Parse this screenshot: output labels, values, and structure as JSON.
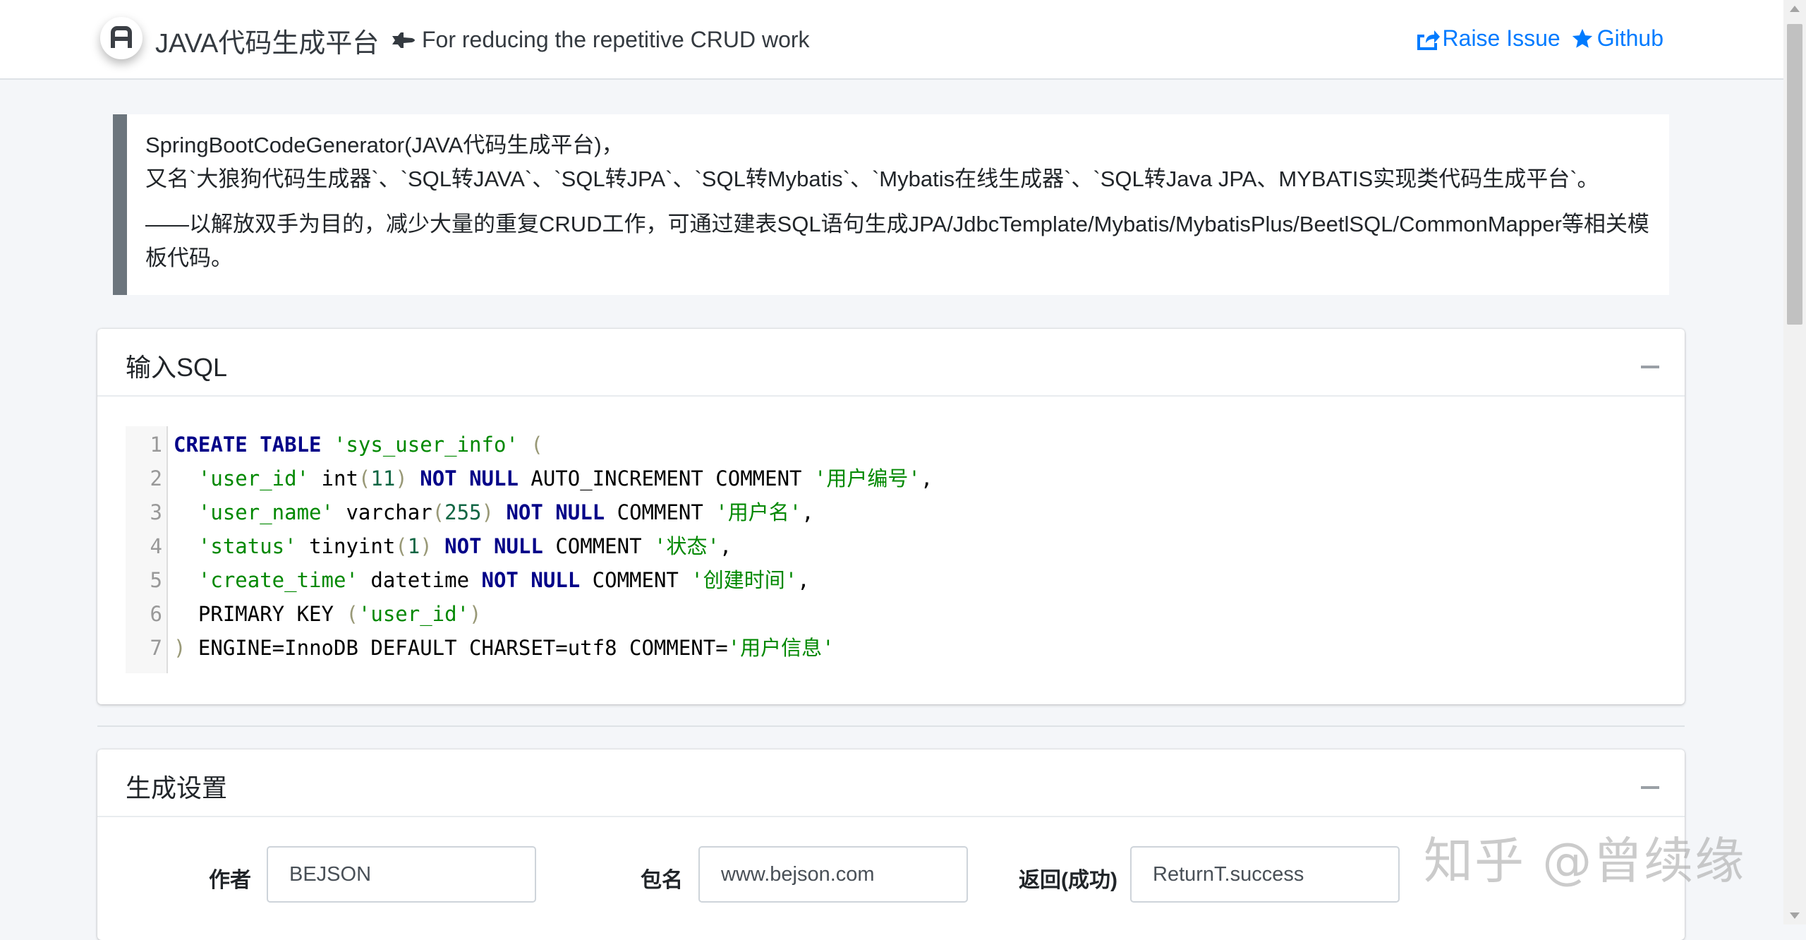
{
  "header": {
    "brand": "JAVA代码生成平台",
    "tagline": "For reducing the repetitive CRUD work",
    "links": [
      {
        "label": "Raise Issue",
        "icon": "share-square-icon"
      },
      {
        "label": "Github",
        "icon": "star-icon"
      }
    ]
  },
  "intro": {
    "line1": "SpringBootCodeGenerator(JAVA代码生成平台)，",
    "line2": "又名`大狼狗代码生成器`、`SQL转JAVA`、`SQL转JPA`、`SQL转Mybatis`、`Mybatis在线生成器`、`SQL转Java JPA、MYBATIS实现类代码生成平台`。",
    "line3": "——以解放双手为目的，减少大量的重复CRUD工作，可通过建表SQL语句生成JPA/JdbcTemplate/Mybatis/MybatisPlus/BeetlSQL/CommonMapper等相关模板代码。"
  },
  "sql_card": {
    "title": "输入SQL",
    "line_numbers": [
      "1",
      "2",
      "3",
      "4",
      "5",
      "6",
      "7"
    ],
    "lines": [
      [
        "CREATE TABLE",
        " ",
        "'sys_user_info'",
        " ",
        "("
      ],
      [
        "  ",
        "'user_id'",
        " int",
        "(",
        "11",
        ")",
        " ",
        "NOT NULL",
        " AUTO_INCREMENT COMMENT ",
        "'用户编号'",
        ","
      ],
      [
        "  ",
        "'user_name'",
        " varchar",
        "(",
        "255",
        ")",
        " ",
        "NOT NULL",
        " COMMENT ",
        "'用户名'",
        ","
      ],
      [
        "  ",
        "'status'",
        " tinyint",
        "(",
        "1",
        ")",
        " ",
        "NOT NULL",
        " COMMENT ",
        "'状态'",
        ","
      ],
      [
        "  ",
        "'create_time'",
        " datetime ",
        "NOT NULL",
        " COMMENT ",
        "'创建时间'",
        ","
      ],
      [
        "  PRIMARY KEY ",
        "(",
        "'user_id'",
        ")"
      ],
      [
        ")",
        " ENGINE=InnoDB DEFAULT CHARSET=utf8 COMMENT=",
        "'用户信息'"
      ]
    ]
  },
  "settings_card": {
    "title": "生成设置",
    "fields": [
      {
        "label": "作者",
        "value": "BEJSON"
      },
      {
        "label": "包名",
        "value": "www.bejson.com"
      },
      {
        "label": "返回(成功)",
        "value": "ReturnT.success"
      }
    ]
  },
  "watermark": "知乎 @曾续缘",
  "colors": {
    "link": "#007bff",
    "keyword": "#000088",
    "string": "#008800",
    "number": "#116644",
    "callout_border": "#6c757d"
  }
}
